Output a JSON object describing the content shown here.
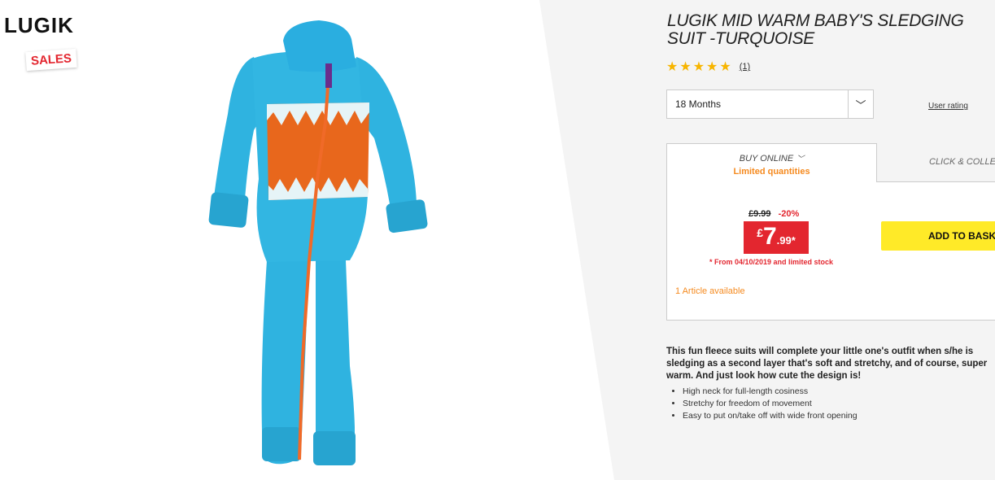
{
  "brand": {
    "logo": "LUGIK",
    "badge": "SALES"
  },
  "product": {
    "title": "LUGIK MID WARM BABY'S SLEDGING SUIT -TURQUOISE",
    "rating": {
      "stars": 5,
      "count": "(1)"
    },
    "image_icon": "baby-sledging-suit-image"
  },
  "size_select": {
    "value": "18 Months",
    "chevron_icon": "chevron-down-icon"
  },
  "user_rating_link": "User rating",
  "buy": {
    "tab_online": "BUY ONLINE",
    "tab_online_note": "Limited quantities",
    "tab_click_collect": "CLICK & COLLECT",
    "old_price": "£9.99",
    "discount": "-20%",
    "price": {
      "currency": "£",
      "integer": "7",
      "decimal": ".99*"
    },
    "price_note": "* From 04/10/2019 and limited stock",
    "availability": "1 Article available",
    "add_to_basket": "ADD TO BASKET"
  },
  "description": "This fun fleece suits will complete your little one's outfit when s/he is sledging as a second layer that's soft and stretchy, and of course, super warm. And just look how cute the design is!",
  "features": [
    "High neck for full-length cosiness",
    "Stretchy for freedom of movement",
    "Easy to put on/take off with wide front opening"
  ],
  "colors": {
    "accent_yellow": "#ffea28",
    "price_red": "#e3262f",
    "orange": "#f58a1f",
    "star": "#f7b500",
    "suit_turquoise": "#2fb3e0",
    "suit_orange": "#e8671c"
  }
}
